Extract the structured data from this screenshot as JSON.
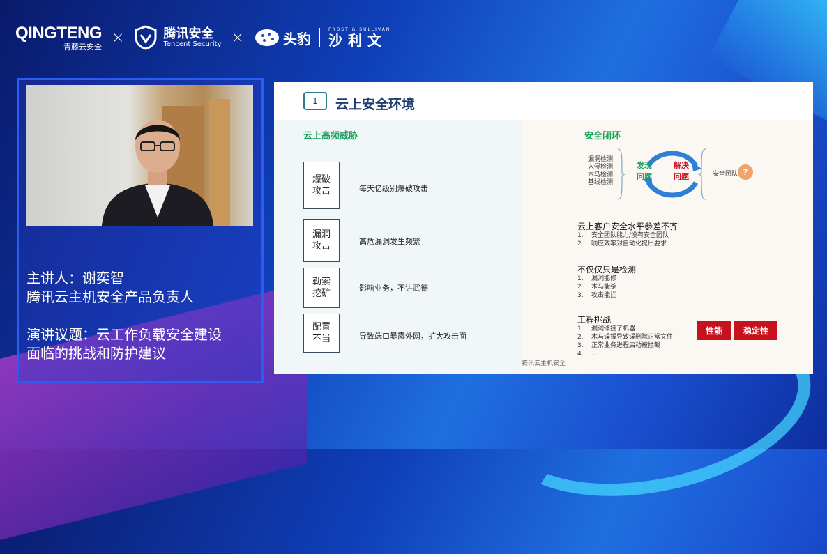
{
  "header": {
    "qingteng_main": "QINGTENG",
    "qingteng_sub": "青藤云安全",
    "tencent_cn": "腾讯安全",
    "tencent_en": "Tencent Security",
    "toutiao": "头豹",
    "fs_en": "FROST & SULLIVAN",
    "fs_cn": "沙利文",
    "cross": "×"
  },
  "speaker": {
    "info": "主讲人：谢奕智\n腾讯云主机安全产品负责人\n\n演讲议题：云工作负载安全建设\n面临的挑战和防护建议"
  },
  "slide": {
    "number": "1",
    "title": "云上安全环境",
    "left_heading": "云上高频威胁",
    "threats": [
      {
        "label": "爆破\n攻击",
        "desc": "每天亿级别爆破攻击"
      },
      {
        "label": "漏洞\n攻击",
        "desc": "高危漏洞发生频繁"
      },
      {
        "label": "勒索\n挖矿",
        "desc": "影响业务，不讲武德"
      },
      {
        "label": "配置\n不当",
        "desc": "导致端口暴露外网，扩大攻击面"
      }
    ],
    "right_heading": "安全闭环",
    "detections": "漏洞检测\n入侵检测\n木马检测\n基线检测\n…",
    "cycle_find": "发现\n问题",
    "cycle_solve": "解决\n问题",
    "team_label": "安全团队",
    "q_mark": "?",
    "sections": [
      {
        "title": "云上客户安全水平参差不齐",
        "items": [
          "安全团队能力/没有安全团队",
          "响应效率对自动化提出要求"
        ]
      },
      {
        "title": "不仅仅只是检测",
        "items": [
          "漏洞能修",
          "木马能杀",
          "攻击能拦"
        ]
      },
      {
        "title": "工程挑战",
        "items": [
          "漏洞修挂了机器",
          "木马误报导致误删除正常文件",
          "正常业务进程启动被拦截",
          "…"
        ]
      }
    ],
    "badges": [
      "性能",
      "稳定性"
    ],
    "footer": "腾讯云主机安全"
  },
  "colors": {
    "accent_green": "#1aa05a",
    "title_navy": "#1d3e6e",
    "badge_red": "#c7121e",
    "cycle_blue": "#2f7fd6"
  }
}
